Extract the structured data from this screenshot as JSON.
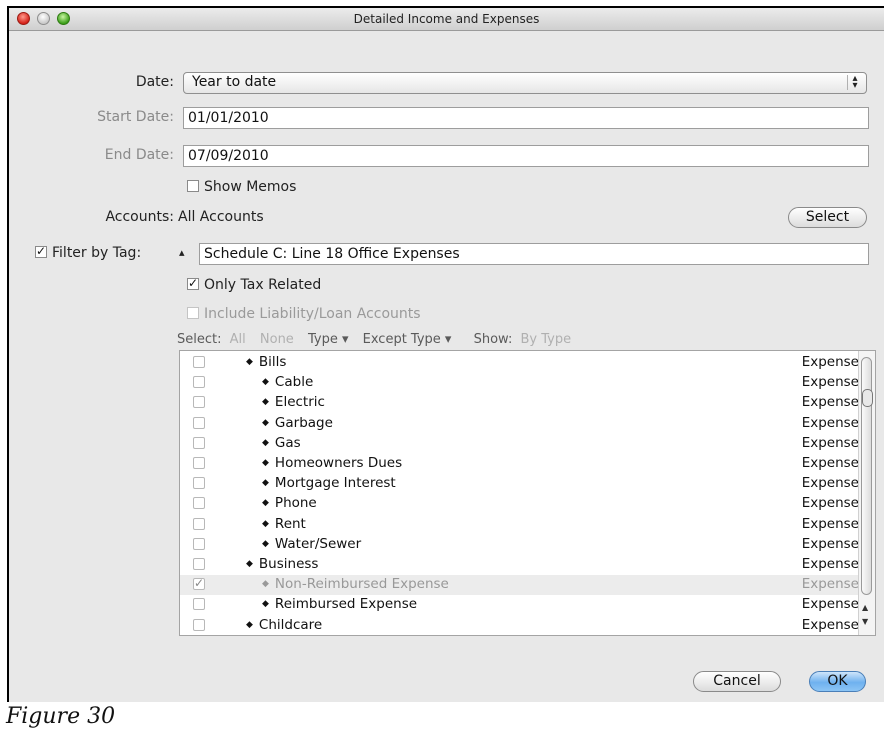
{
  "window": {
    "title": "Detailed Income and Expenses"
  },
  "form": {
    "date_label": "Date:",
    "date_value": "Year to date",
    "start_label": "Start Date:",
    "start_value": "01/01/2010",
    "end_label": "End Date:",
    "end_value": "07/09/2010",
    "show_memos": "Show Memos",
    "accounts_label": "Accounts:",
    "accounts_value": "All Accounts",
    "select_button": "Select",
    "filter_label": "Filter by Tag:",
    "filter_value": "Schedule C: Line 18 Office Expenses",
    "only_tax": "Only Tax Related",
    "include_liability": "Include Liability/Loan Accounts"
  },
  "selectbar": {
    "select": "Select:",
    "all": "All",
    "none": "None",
    "type": "Type ▾",
    "except_type": "Except Type ▾",
    "show": "Show:",
    "by_type": "By Type"
  },
  "accounts": [
    {
      "name": "Bills",
      "type": "Expense",
      "level": 1,
      "checked": false
    },
    {
      "name": "Cable",
      "type": "Expense",
      "level": 2,
      "checked": false
    },
    {
      "name": "Electric",
      "type": "Expense",
      "level": 2,
      "checked": false
    },
    {
      "name": "Garbage",
      "type": "Expense",
      "level": 2,
      "checked": false
    },
    {
      "name": "Gas",
      "type": "Expense",
      "level": 2,
      "checked": false
    },
    {
      "name": "Homeowners Dues",
      "type": "Expense",
      "level": 2,
      "checked": false
    },
    {
      "name": "Mortgage Interest",
      "type": "Expense",
      "level": 2,
      "checked": false
    },
    {
      "name": "Phone",
      "type": "Expense",
      "level": 2,
      "checked": false
    },
    {
      "name": "Rent",
      "type": "Expense",
      "level": 2,
      "checked": false
    },
    {
      "name": "Water/Sewer",
      "type": "Expense",
      "level": 2,
      "checked": false
    },
    {
      "name": "Business",
      "type": "Expense",
      "level": 1,
      "checked": false
    },
    {
      "name": "Non-Reimbursed Expense",
      "type": "Expense",
      "level": 2,
      "checked": true
    },
    {
      "name": "Reimbursed Expense",
      "type": "Expense",
      "level": 2,
      "checked": false
    },
    {
      "name": "Childcare",
      "type": "Expense",
      "level": 1,
      "checked": false
    }
  ],
  "buttons": {
    "cancel": "Cancel",
    "ok": "OK"
  },
  "caption": "Figure 30"
}
